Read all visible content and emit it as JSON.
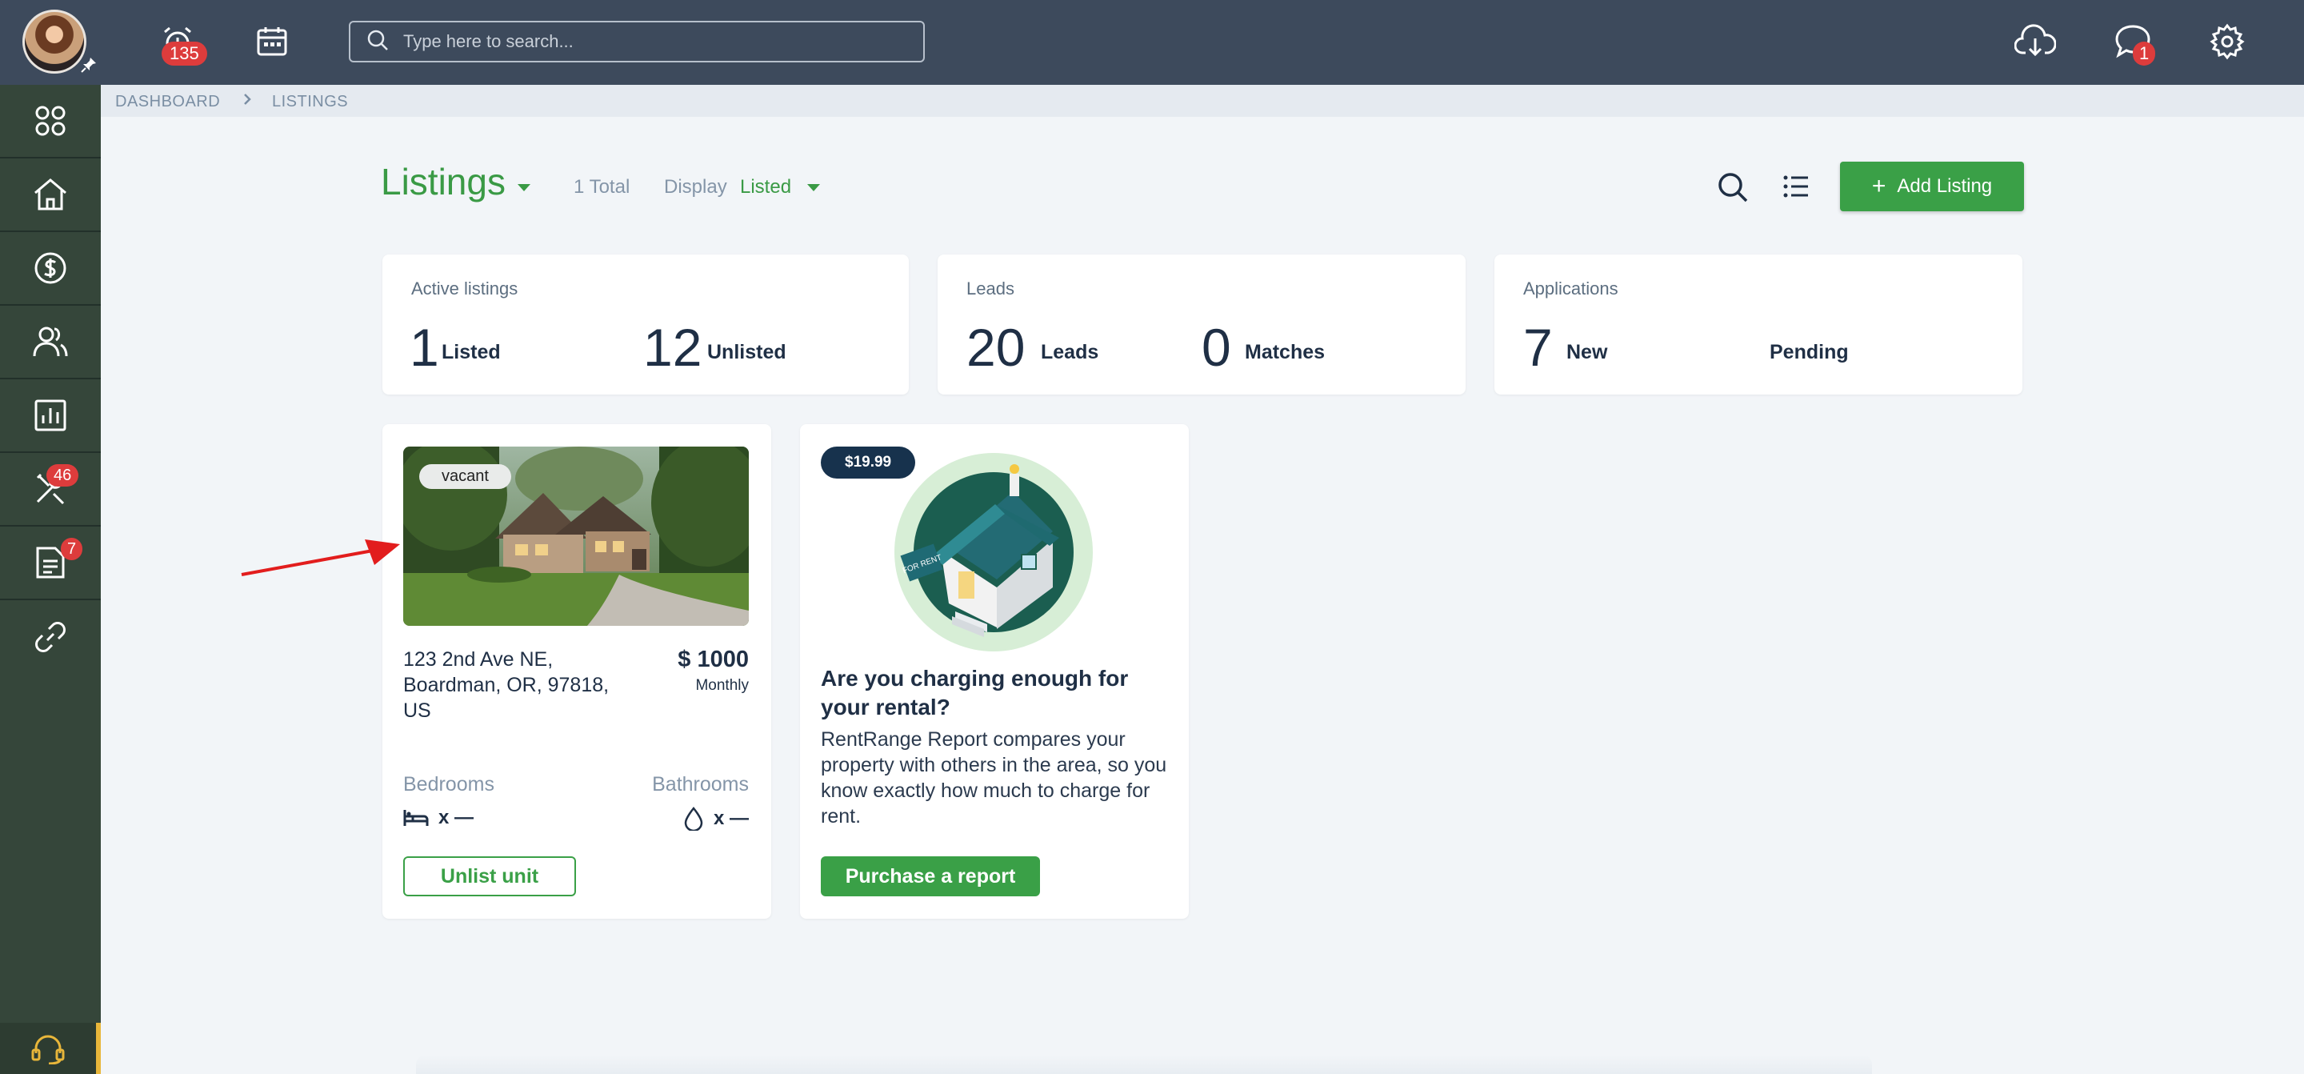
{
  "topbar": {
    "alarm_badge": "135",
    "search_placeholder": "Type here to search...",
    "messages_badge": "1"
  },
  "sidebar": {
    "items": [
      {
        "name": "dashboard"
      },
      {
        "name": "properties"
      },
      {
        "name": "payments"
      },
      {
        "name": "people"
      },
      {
        "name": "reports"
      },
      {
        "name": "maintenance",
        "badge": "46"
      },
      {
        "name": "documents",
        "badge": "7"
      },
      {
        "name": "links"
      }
    ]
  },
  "breadcrumb": {
    "items": [
      "DASHBOARD",
      "LISTINGS"
    ]
  },
  "header": {
    "title": "Listings",
    "total": "1 Total",
    "display_label": "Display",
    "display_value": "Listed",
    "add_button": "Add Listing"
  },
  "stats": [
    {
      "label": "Active listings",
      "values": [
        {
          "number": "1",
          "text": "Listed"
        },
        {
          "number": "12",
          "text": "Unlisted"
        }
      ]
    },
    {
      "label": "Leads",
      "values": [
        {
          "number": "20",
          "text": "Leads"
        },
        {
          "number": "0",
          "text": "Matches"
        }
      ]
    },
    {
      "label": "Applications",
      "values": [
        {
          "number": "7",
          "text": "New"
        },
        {
          "number": "",
          "text": "Pending"
        }
      ]
    }
  ],
  "listing": {
    "status": "vacant",
    "address_line1": "123 2nd Ave NE,",
    "address_line2": "Boardman, OR, 97818,",
    "address_line3": "US",
    "price": "$ 1000",
    "period": "Monthly",
    "bedrooms_label": "Bedrooms",
    "bedrooms_value": "x —",
    "bathrooms_label": "Bathrooms",
    "bathrooms_value": "x —",
    "unlist_button": "Unlist unit"
  },
  "promo": {
    "price": "$19.99",
    "title": "Are you charging enough for your rental?",
    "text": "RentRange Report compares your property with others in the area, so you know exactly how much to charge for rent.",
    "button": "Purchase a report",
    "sign_text": "FOR RENT"
  },
  "colors": {
    "topbar": "#3d4a5c",
    "sidebar": "#35463a",
    "accent_green": "#3aa047",
    "badge_red": "#dd3c3c",
    "navy": "#17324d"
  }
}
